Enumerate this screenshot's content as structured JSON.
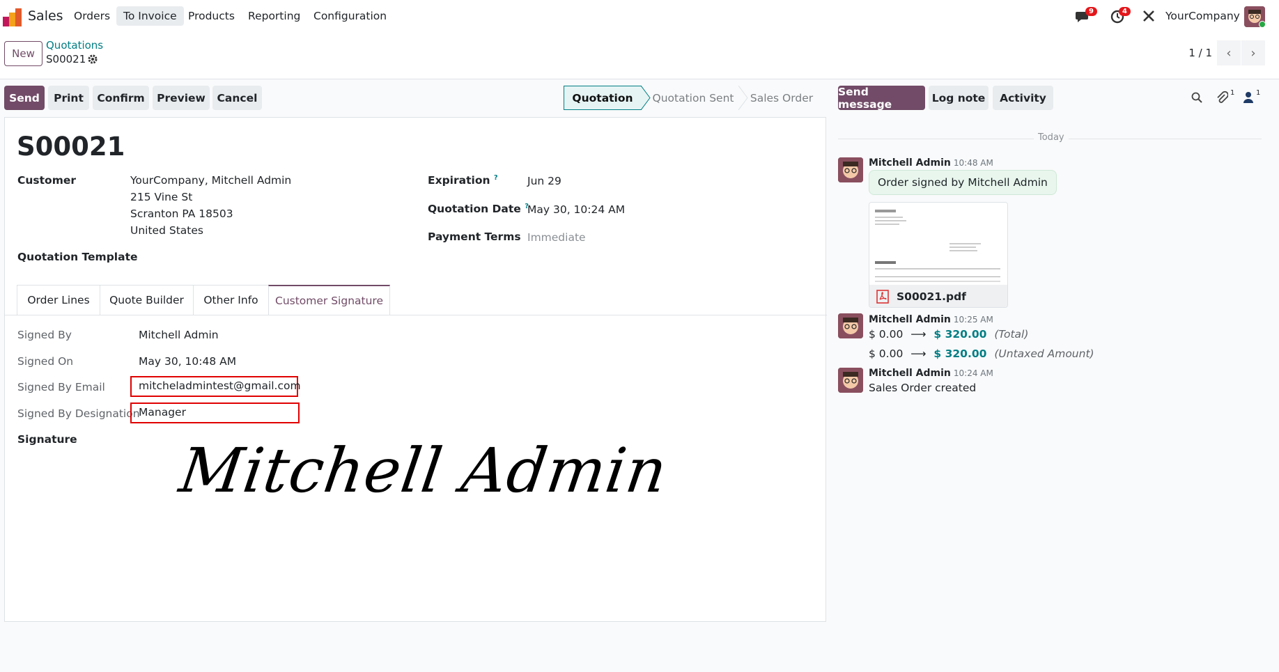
{
  "navbar": {
    "app_name": "Sales",
    "menu": [
      "Orders",
      "To Invoice",
      "Products",
      "Reporting",
      "Configuration"
    ],
    "messages_count": "9",
    "activities_count": "4",
    "company": "YourCompany"
  },
  "control_panel": {
    "new_label": "New",
    "breadcrumb_parent": "Quotations",
    "breadcrumb_current": "S00021",
    "pager": "1 / 1"
  },
  "actions": [
    "Send",
    "Print",
    "Confirm",
    "Preview",
    "Cancel"
  ],
  "statusbar": [
    "Quotation",
    "Quotation Sent",
    "Sales Order"
  ],
  "form": {
    "title": "S00021",
    "customer_label": "Customer",
    "customer_lines": [
      "YourCompany, Mitchell Admin",
      "215 Vine St",
      "Scranton PA 18503",
      "United States"
    ],
    "expiration_label": "Expiration",
    "expiration_value": "Jun 29",
    "quotation_date_label": "Quotation Date",
    "quotation_date_value": "May 30, 10:24 AM",
    "payment_terms_label": "Payment Terms",
    "payment_terms_value": "Immediate",
    "template_label": "Quotation Template",
    "help_mark": "?"
  },
  "tabs": [
    "Order Lines",
    "Quote Builder",
    "Other Info",
    "Customer Signature"
  ],
  "signature": {
    "signed_by_label": "Signed By",
    "signed_by_value": "Mitchell Admin",
    "signed_on_label": "Signed On",
    "signed_on_value": "May 30, 10:48 AM",
    "email_label": "Signed By Email",
    "email_value": "mitcheladmintest@gmail.com",
    "designation_label": "Signed By Designation",
    "designation_value": "Manager",
    "signature_label": "Signature",
    "signature_text": "Mitchell Admin"
  },
  "chatter": {
    "send_message": "Send message",
    "log_note": "Log note",
    "activity": "Activity",
    "attachments_count": "1",
    "followers_count": "1",
    "date_separator": "Today",
    "messages": [
      {
        "author": "Mitchell Admin",
        "time": "10:48 AM",
        "body": "Order signed by Mitchell Admin",
        "attachment": "S00021.pdf"
      },
      {
        "author": "Mitchell Admin",
        "time": "10:25 AM",
        "tracking": [
          {
            "old": "$ 0.00",
            "new": "$ 320.00",
            "field": "(Total)"
          },
          {
            "old": "$ 0.00",
            "new": "$ 320.00",
            "field": "(Untaxed Amount)"
          }
        ]
      },
      {
        "author": "Mitchell Admin",
        "time": "10:24 AM",
        "body": "Sales Order created"
      }
    ]
  },
  "colors": {
    "primary": "#714b67",
    "teal": "#017e84",
    "badge": "#e3171b",
    "highlight": "#e00000"
  }
}
